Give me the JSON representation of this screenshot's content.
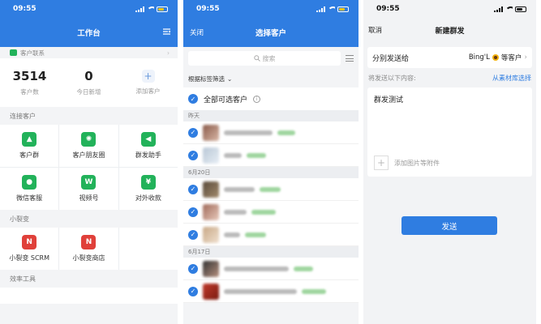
{
  "status_time": "09:55",
  "workbench": {
    "title": "工作台",
    "contacts_section": "客户联系",
    "stats": [
      {
        "value": "3514",
        "label": "客户数"
      },
      {
        "value": "0",
        "label": "今日新增"
      },
      {
        "icon": "plus-icon",
        "label": "添加客户"
      }
    ],
    "connect_section": "连接客户",
    "connect_items": [
      {
        "label": "客户群",
        "icon": "group-icon",
        "color": "#22b25a"
      },
      {
        "label": "客户朋友圈",
        "icon": "moments-icon",
        "color": "#22b25a"
      },
      {
        "label": "群发助手",
        "icon": "megaphone-icon",
        "color": "#22b25a"
      },
      {
        "label": "微信客服",
        "icon": "chat-icon",
        "color": "#22b25a"
      },
      {
        "label": "视频号",
        "icon": "channels-icon",
        "color": "#22b25a"
      },
      {
        "label": "对外收款",
        "icon": "payment-icon",
        "color": "#22b25a"
      }
    ],
    "fission_section": "小裂变",
    "fission_items": [
      {
        "label": "小裂变 SCRM",
        "icon": "fission-logo-icon",
        "color": "#e0403a"
      },
      {
        "label": "小裂变商店",
        "icon": "fission-logo-icon",
        "color": "#e0403a"
      }
    ],
    "tools_section": "效率工具"
  },
  "select": {
    "close": "关闭",
    "title": "选择客户",
    "search_placeholder": "搜索",
    "tag_filter": "根据标签筛选",
    "select_all": "全部可选客户",
    "groups": [
      {
        "date": "昨天",
        "count": 2
      },
      {
        "date": "6月20日",
        "count": 3
      },
      {
        "date": "6月17日",
        "count": 2
      }
    ]
  },
  "compose": {
    "cancel": "取消",
    "title": "新建群发",
    "send_to_label": "分别发送给",
    "send_to_name": "Bing'L",
    "send_to_suffix": "等客户",
    "prompt": "将发送以下内容:",
    "library_link": "从素材库选择",
    "message": "群发测试",
    "attach_label": "添加图片等附件",
    "send_button": "发送"
  },
  "colors": {
    "accent": "#2f7de1",
    "green": "#22b25a",
    "red": "#e0403a"
  }
}
